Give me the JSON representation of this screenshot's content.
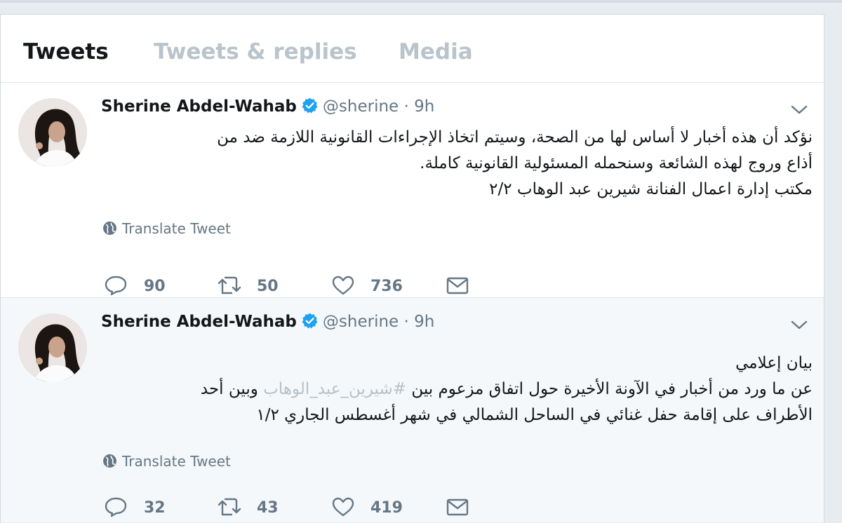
{
  "tabs": [
    {
      "label": "Tweets",
      "active": true
    },
    {
      "label": "Tweets & replies",
      "active": false
    },
    {
      "label": "Media",
      "active": false
    }
  ],
  "tweets": [
    {
      "author_name": "Sherine Abdel-Wahab",
      "verified": true,
      "handle": "@sherine",
      "separator": "·",
      "time": "9h",
      "lines": [
        "نؤكد أن هذه أخبار لا أساس لها من الصحة، وسيتم اتخاذ الإجراءات القانونية اللازمة ضد من",
        "أذاع وروج لهذه الشائعة وسنحمله المسئولية القانونية كاملة.",
        "مكتب إدارة اعمال الفنانة شيرين عبد الوهاب ٢/٢"
      ],
      "translate_label": "Translate Tweet",
      "replies": "90",
      "retweets": "50",
      "likes": "736"
    },
    {
      "author_name": "Sherine Abdel-Wahab",
      "verified": true,
      "handle": "@sherine",
      "separator": "·",
      "time": "9h",
      "line1": "بيان إعلامي",
      "line2_pre": "عن ما ورد من أخبار في الآونة الأخيرة حول اتفاق مزعوم بين ",
      "line2_hashtag": "#شيرين_عبد_الوهاب",
      "line2_post": " وبين أحد",
      "line3": "الأطراف على إقامة حفل غنائي في الساحل الشمالي في شهر أغسطس الجاري ١/٢",
      "translate_label": "Translate Tweet",
      "replies": "32",
      "retweets": "43",
      "likes": "419"
    }
  ],
  "colors": {
    "page_background": "#e6ecf0",
    "text_primary": "#14171a",
    "text_secondary": "#657786",
    "verified_badge": "#1da1f2",
    "inactive_tab": "#b9c4cc"
  },
  "icons": [
    "verified-badge-icon",
    "chevron-down-icon",
    "globe-icon",
    "reply-icon",
    "retweet-icon",
    "heart-icon",
    "envelope-icon"
  ]
}
